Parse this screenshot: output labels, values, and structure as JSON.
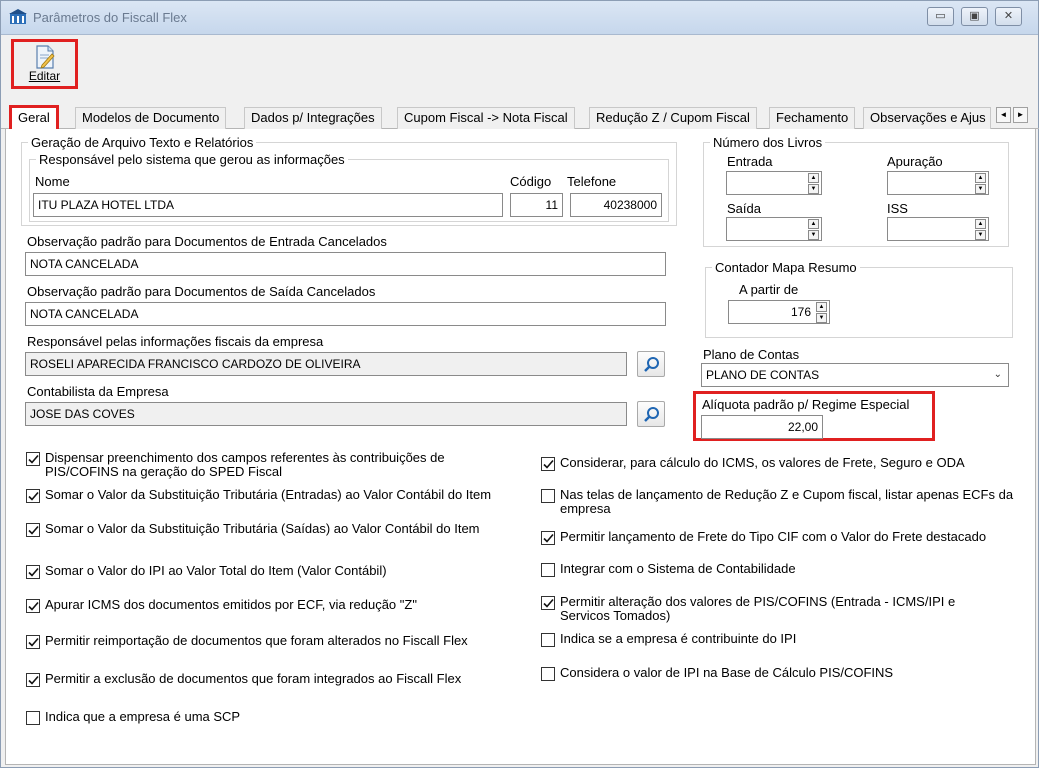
{
  "window": {
    "title": "Parâmetros do Fiscall Flex",
    "btn_min": "▭",
    "btn_max": "▣",
    "btn_close": "✕"
  },
  "toolbar": {
    "edit_label": "Editar"
  },
  "tabs": [
    "Geral",
    "Modelos de Documento",
    "Dados p/ Integrações",
    "Cupom Fiscal -> Nota Fiscal",
    "Redução Z / Cupom Fiscal",
    "Fechamento",
    "Observações e Ajus"
  ],
  "tab_scroll": {
    "left": "◄",
    "right": "►"
  },
  "geracao": {
    "title": "Geração de Arquivo Texto e Relatórios",
    "responsavel": {
      "title": "Responsável pelo sistema que gerou as informações",
      "nome_label": "Nome",
      "nome_value": "ITU PLAZA HOTEL LTDA",
      "codigo_label": "Código",
      "codigo_value": "11",
      "telefone_label": "Telefone",
      "telefone_value": "40238000"
    }
  },
  "obs_entrada": {
    "label": "Observação padrão para Documentos de Entrada Cancelados",
    "value": "NOTA CANCELADA"
  },
  "obs_saida": {
    "label": "Observação padrão para Documentos de Saída Cancelados",
    "value": "NOTA CANCELADA"
  },
  "resp_fiscal": {
    "label": "Responsável pelas informações fiscais da empresa",
    "value": "ROSELI APARECIDA FRANCISCO CARDOZO DE OLIVEIRA"
  },
  "contabilista": {
    "label": "Contabilista da Empresa",
    "value": "JOSE DAS COVES"
  },
  "livros": {
    "title": "Número dos Livros",
    "entrada_label": "Entrada",
    "apuracao_label": "Apuração",
    "saida_label": "Saída",
    "iss_label": "ISS"
  },
  "contador": {
    "title": "Contador Mapa Resumo",
    "label": "A partir de",
    "value": "176"
  },
  "plano": {
    "label": "Plano de Contas",
    "value": "PLANO DE CONTAS"
  },
  "aliquota": {
    "label": "Alíquota padrão p/ Regime Especial",
    "value": "22,00"
  },
  "checks_left": [
    {
      "text": "Dispensar preenchimento dos campos referentes às contribuições de PIS/COFINS na geração do SPED Fiscal",
      "checked": true
    },
    {
      "text": "Somar o Valor da Substituição Tributária (Entradas) ao Valor Contábil do Item",
      "checked": true
    },
    {
      "text": "Somar o Valor da Substituição Tributária (Saídas) ao Valor Contábil do Item",
      "checked": true
    },
    {
      "text": "Somar o Valor do IPI ao Valor Total do Item (Valor Contábil)",
      "checked": true
    },
    {
      "text": "Apurar ICMS dos documentos emitidos por ECF, via redução \"Z\"",
      "checked": true
    },
    {
      "text": "Permitir reimportação de documentos que foram alterados no Fiscall Flex",
      "checked": true
    },
    {
      "text": "Permitir a exclusão de documentos que foram integrados ao Fiscall Flex",
      "checked": true
    },
    {
      "text": "Indica que a empresa é uma SCP",
      "checked": false
    }
  ],
  "checks_right": [
    {
      "text": "Considerar, para cálculo do ICMS, os valores de Frete, Seguro e ODA",
      "checked": true
    },
    {
      "text": "Nas telas de lançamento de Redução Z e Cupom fiscal, listar apenas ECFs da empresa",
      "checked": false
    },
    {
      "text": "Permitir lançamento de Frete do Tipo CIF com o Valor do Frete destacado",
      "checked": true
    },
    {
      "text": "Integrar com o Sistema de Contabilidade",
      "checked": false
    },
    {
      "text": "Permitir alteração dos valores de PIS/COFINS (Entrada - ICMS/IPI e Servicos Tomados)",
      "checked": true
    },
    {
      "text": "Indica se a empresa é contribuinte do IPI",
      "checked": false
    },
    {
      "text": "Considera o valor de IPI na Base de Cálculo PIS/COFINS",
      "checked": false
    }
  ],
  "colors": {
    "highlight": "#e02020",
    "titlebar": "#c6d7ec"
  },
  "icons": {
    "app": "building-icon",
    "edit": "edit-document-icon",
    "lookup": "search-icon"
  }
}
